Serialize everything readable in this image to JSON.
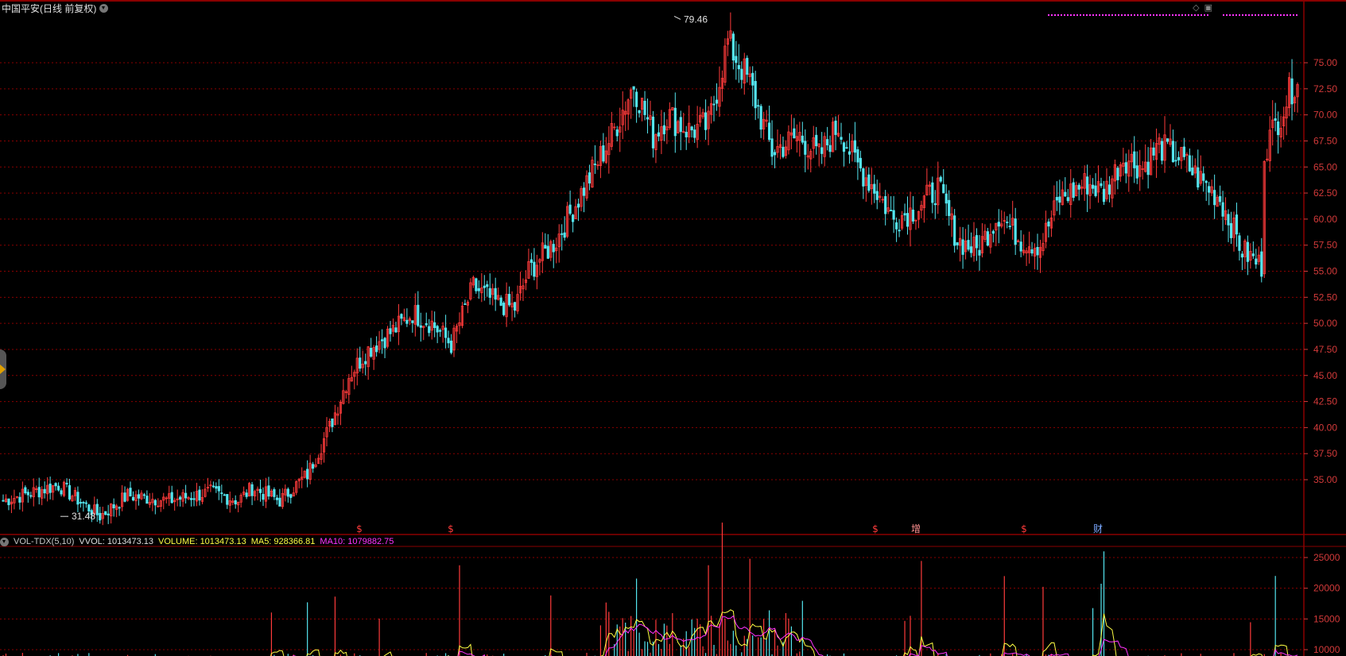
{
  "title": {
    "stock_name": "中国平安(日线 前复权)"
  },
  "volume_indicator": {
    "name": "VOL-TDX(5,10)",
    "vvol_label": "VVOL: 1013473.13",
    "volume_label": "VOLUME: 1013473.13",
    "ma5_label": "MA5: 928366.81",
    "ma10_label": "MA10: 1079882.75"
  },
  "colors": {
    "up": "#ff3b3b",
    "down": "#54e5ef",
    "grid": "#8a0000",
    "axis_text": "#d33a3a",
    "volume_text": "#ffff44",
    "ma10": "#ff33ff",
    "vvol": "#e0e0e0"
  },
  "markers": [
    {
      "text": "$",
      "color": "#ff3b3b"
    },
    {
      "text": "$",
      "color": "#ff3b3b"
    },
    {
      "text": "$",
      "color": "#ff3b3b"
    },
    {
      "text": "增",
      "color": "#ff9090"
    },
    {
      "text": "$",
      "color": "#ff3b3b"
    },
    {
      "text": "财",
      "color": "#7aa8ff"
    }
  ],
  "chart_data": [
    {
      "type": "candlestick",
      "title": "中国平安(日线 前复权)",
      "y_ticks": [
        "75.00",
        "72.50",
        "70.00",
        "67.50",
        "65.00",
        "62.50",
        "60.00",
        "57.50",
        "55.00",
        "52.50",
        "50.00",
        "47.50",
        "45.00",
        "42.50",
        "40.00",
        "37.50",
        "35.00"
      ],
      "ylim": [
        31.0,
        80.5
      ],
      "annotations": [
        {
          "text": "79.46",
          "value": 79.46,
          "kind": "high"
        },
        {
          "text": "31.48",
          "value": 31.48,
          "kind": "low"
        }
      ],
      "close_path": {
        "x_index": [
          0,
          20,
          35,
          45,
          60,
          75,
          85,
          90,
          100,
          110,
          118,
          125,
          132,
          142,
          148,
          155,
          162,
          170,
          178,
          185,
          190,
          200,
          210,
          220,
          228,
          235,
          240,
          248,
          255,
          262,
          270,
          278,
          288,
          295,
          302,
          308,
          315,
          322,
          330,
          338,
          345,
          352,
          360,
          368,
          375,
          382,
          392,
          398,
          405,
          412,
          418,
          425,
          432,
          440,
          448,
          455,
          460,
          468
        ],
        "close": [
          33.0,
          34.5,
          31.5,
          33.5,
          33.0,
          33.8,
          33.0,
          34.2,
          33.0,
          35.5,
          40.0,
          45.0,
          47.5,
          49.5,
          51.0,
          50.0,
          48.0,
          53.5,
          52.0,
          51.5,
          55.0,
          58.0,
          63.0,
          68.0,
          73.0,
          68.0,
          70.0,
          68.5,
          69.0,
          77.0,
          73.0,
          66.5,
          68.0,
          66.0,
          69.0,
          65.5,
          63.0,
          60.0,
          61.0,
          63.0,
          58.0,
          57.0,
          60.5,
          58.0,
          57.5,
          62.0,
          63.5,
          62.5,
          66.0,
          65.0,
          67.0,
          66.0,
          64.0,
          62.0,
          57.0,
          55.5,
          58.0,
          63.0
        ]
      },
      "series_tail_note": "final bars rally to 71-75"
    },
    {
      "type": "bar",
      "title": "VOL-TDX(5,10)",
      "y_ticks": [
        "25000",
        "20000",
        "15000",
        "10000"
      ],
      "ylim": [
        8000,
        27500
      ],
      "series": [
        {
          "name": "VOLUME",
          "color": "#ffff44"
        },
        {
          "name": "MA5",
          "color": "#ffff44"
        },
        {
          "name": "MA10",
          "color": "#ff33ff"
        }
      ]
    }
  ]
}
